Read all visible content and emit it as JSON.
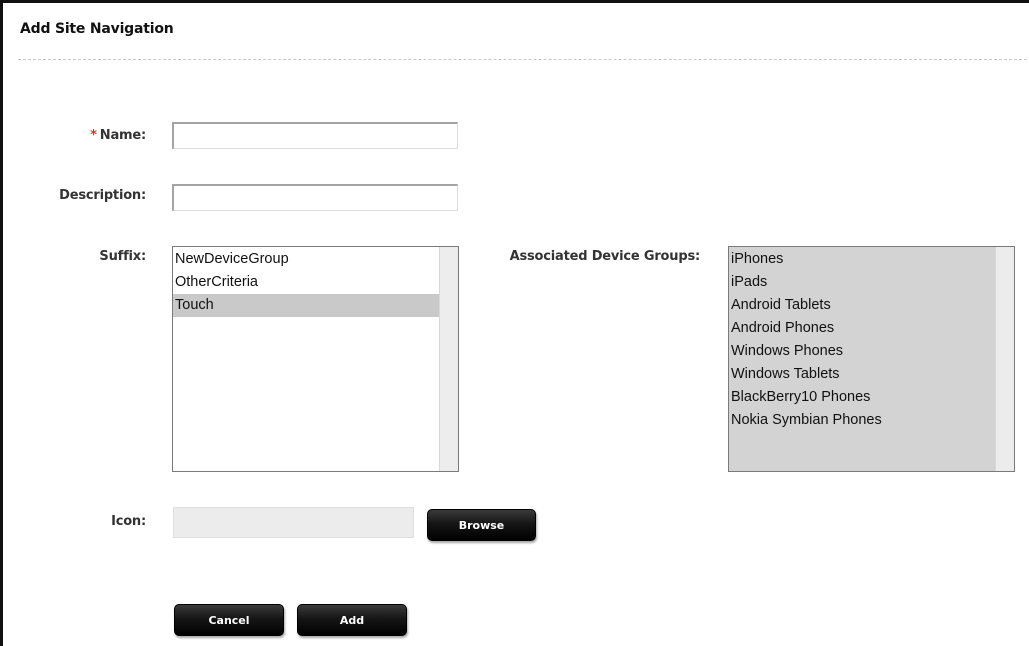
{
  "header": {
    "title": "Add Site Navigation"
  },
  "form": {
    "name_label": "Name:",
    "required_marker": "*",
    "name_value": "",
    "description_label": "Description:",
    "description_value": "",
    "suffix_label": "Suffix:",
    "suffix_items": [
      {
        "label": "NewDeviceGroup",
        "selected": false
      },
      {
        "label": "OtherCriteria",
        "selected": false
      },
      {
        "label": "Touch",
        "selected": true
      }
    ],
    "groups_label": "Associated Device Groups:",
    "group_items": [
      "iPhones",
      "iPads",
      "Android Tablets",
      "Android Phones",
      "Windows Phones",
      "Windows Tablets",
      "BlackBerry10 Phones",
      "Nokia Symbian Phones"
    ],
    "icon_label": "Icon:",
    "icon_value": "",
    "browse_label": "Browse"
  },
  "actions": {
    "cancel_label": "Cancel",
    "add_label": "Add"
  },
  "colors": {
    "required": "#d9361e",
    "button": "#000000",
    "selected_row": "#c9c9c9",
    "disabled_list": "#d3d3d3"
  }
}
